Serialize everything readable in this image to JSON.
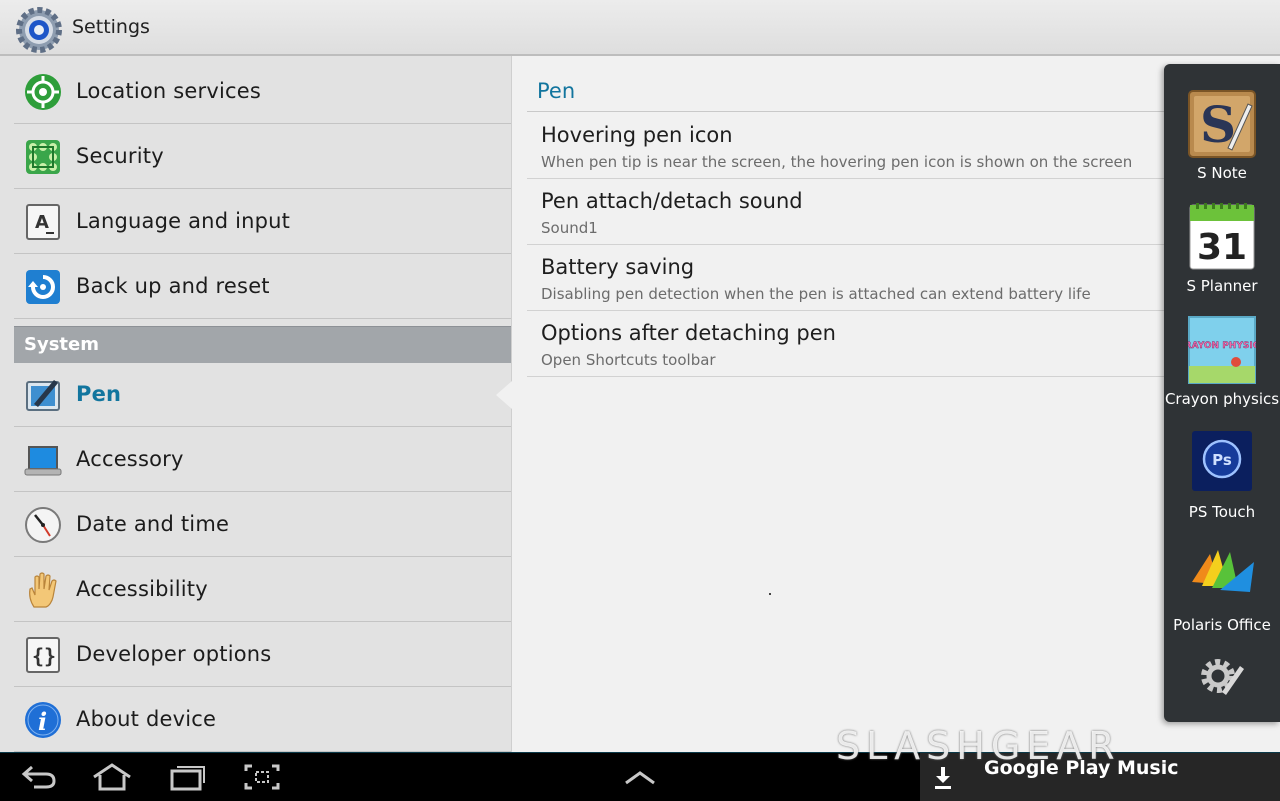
{
  "header": {
    "title": "Settings",
    "app_icon": "settings-gear-icon"
  },
  "sidebar": {
    "items_top": [
      {
        "label": "Location services",
        "icon": "location-icon"
      },
      {
        "label": "Security",
        "icon": "security-grid-icon"
      },
      {
        "label": "Language and input",
        "icon": "keyboard-a-icon"
      },
      {
        "label": "Back up and reset",
        "icon": "backup-reset-icon"
      }
    ],
    "section_header": "System",
    "items_system": [
      {
        "label": "Pen",
        "icon": "pen-tablet-icon",
        "active": true
      },
      {
        "label": "Accessory",
        "icon": "laptop-accessory-icon"
      },
      {
        "label": "Date and time",
        "icon": "clock-icon"
      },
      {
        "label": "Accessibility",
        "icon": "hand-icon"
      },
      {
        "label": "Developer options",
        "icon": "braces-icon"
      },
      {
        "label": "About device",
        "icon": "info-icon"
      }
    ]
  },
  "detail": {
    "section_title": "Pen",
    "options": [
      {
        "title": "Hovering pen icon",
        "summary": "When pen tip is near the screen, the hovering pen icon is shown on the screen"
      },
      {
        "title": "Pen attach/detach sound",
        "summary": "Sound1"
      },
      {
        "title": "Battery saving",
        "summary": "Disabling pen detection when the pen is attached can extend battery life"
      },
      {
        "title": "Options after detaching pen",
        "summary": "Open Shortcuts toolbar"
      }
    ]
  },
  "tray": {
    "apps": [
      {
        "label": "S Note",
        "icon": "s-note-icon"
      },
      {
        "label": "S Planner",
        "icon": "calendar-icon",
        "icon_text": "31"
      },
      {
        "label": "Crayon physics",
        "icon": "crayon-physics-icon",
        "icon_text": "CRAYON PHYSICS"
      },
      {
        "label": "PS Touch",
        "icon": "ps-touch-icon",
        "icon_text": "Ps"
      },
      {
        "label": "Polaris Office",
        "icon": "polaris-office-icon"
      }
    ],
    "edit_icon": "gear-pen-icon"
  },
  "navbar": {
    "buttons": [
      "back-icon",
      "home-icon",
      "recent-apps-icon",
      "screenshot-icon",
      "chevron-up-icon"
    ],
    "now_playing": "Google Play Music"
  },
  "watermark": "SLASHGEAR",
  "colors": {
    "accent": "#12759e",
    "tray": "#2f3336",
    "section_header": "#a2a6aa"
  }
}
